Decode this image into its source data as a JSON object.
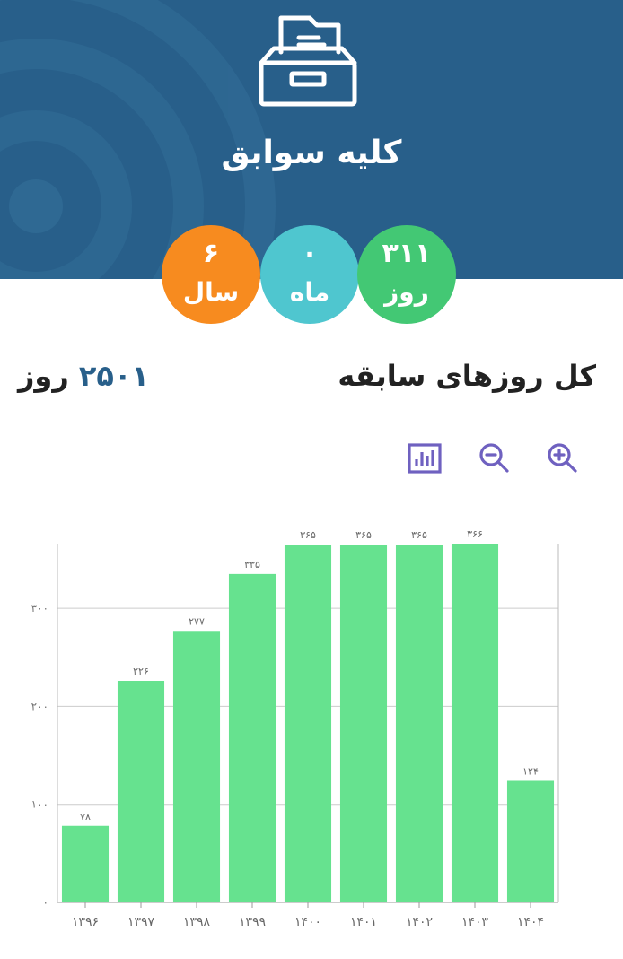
{
  "header": {
    "title": "کلیه سوابق",
    "icon": "archive-box-icon"
  },
  "badges": [
    {
      "key": "years",
      "value": "۶",
      "unit": "سال",
      "color": "#f78b1f"
    },
    {
      "key": "months",
      "value": "۰",
      "unit": "ماه",
      "color": "#4fc6cf"
    },
    {
      "key": "days",
      "value": "۳۱۱",
      "unit": "روز",
      "color": "#43c874"
    }
  ],
  "total": {
    "label": "کل روزهای سابقه",
    "value": "۲۵۰۱",
    "unit": "روز"
  },
  "toolbar": {
    "icons": [
      "bar-chart-icon",
      "zoom-out-icon",
      "zoom-in-icon"
    ],
    "color": "#6f61c0"
  },
  "colors": {
    "header_bg": "#285f8a",
    "bar": "#66e28f"
  },
  "chart_data": {
    "type": "bar",
    "categories": [
      "۱۳۹۶",
      "۱۳۹۷",
      "۱۳۹۸",
      "۱۳۹۹",
      "۱۴۰۰",
      "۱۴۰۱",
      "۱۴۰۲",
      "۱۴۰۳",
      "۱۴۰۴"
    ],
    "values": [
      78,
      226,
      277,
      335,
      365,
      365,
      365,
      366,
      124
    ],
    "value_labels": [
      "۷۸",
      "۲۲۶",
      "۲۷۷",
      "۳۳۵",
      "۳۶۵",
      "۳۶۵",
      "۳۶۵",
      "۳۶۶",
      "۱۲۴"
    ],
    "y_ticks": [
      0,
      100,
      200,
      300
    ],
    "y_tick_labels": [
      "۰",
      "۱۰۰",
      "۲۰۰",
      "۳۰۰"
    ],
    "ylim": [
      0,
      366
    ],
    "grid": true,
    "title": "",
    "xlabel": "",
    "ylabel": ""
  }
}
